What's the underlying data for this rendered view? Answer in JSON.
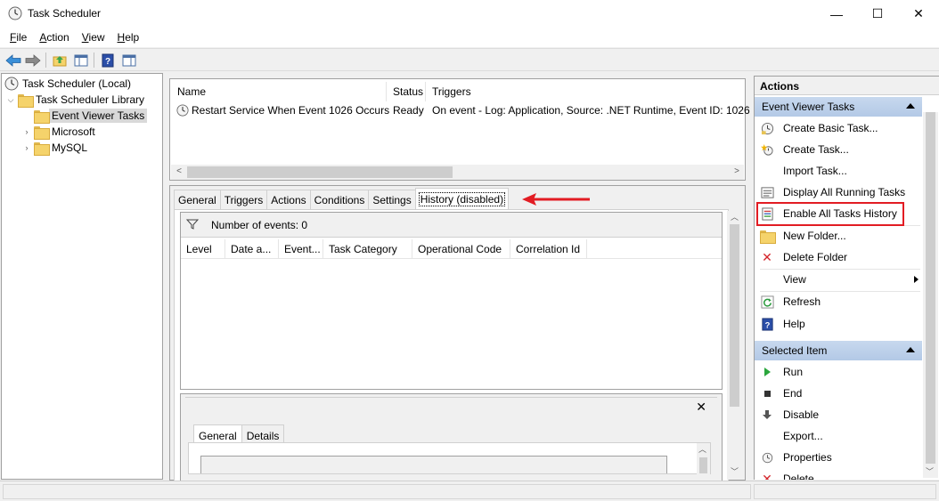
{
  "window": {
    "title": "Task Scheduler"
  },
  "window_controls": {
    "minimize": "—",
    "maximize": "☐",
    "close": "✕"
  },
  "menu": {
    "file": "File",
    "action": "Action",
    "view": "View",
    "help": "Help"
  },
  "menu_hotkeys": {
    "file": "F",
    "action": "A",
    "view": "V",
    "help": "H"
  },
  "menu_rest": {
    "file": "ile",
    "action": "ction",
    "view": "iew",
    "help": "elp"
  },
  "tree": {
    "root": "Task Scheduler (Local)",
    "library": "Task Scheduler Library",
    "items": [
      "Event Viewer Tasks",
      "Microsoft",
      "MySQL"
    ]
  },
  "task_list": {
    "columns": [
      "Name",
      "Status",
      "Triggers"
    ],
    "rows": [
      {
        "name": "Restart Service When Event 1026 Occurs",
        "status": "Ready",
        "triggers": "On event - Log: Application, Source: .NET Runtime, Event ID: 1026"
      }
    ]
  },
  "detail_tabs": [
    "General",
    "Triggers",
    "Actions",
    "Conditions",
    "Settings",
    "History (disabled)"
  ],
  "history": {
    "events_count": "Number of events: 0",
    "columns": [
      "Level",
      "Date a...",
      "Event...",
      "Task Category",
      "Operational Code",
      "Correlation Id"
    ],
    "close": "✕",
    "inner_tabs": [
      "General",
      "Details"
    ]
  },
  "actions": {
    "title": "Actions",
    "section1": "Event Viewer Tasks",
    "section1_items": [
      "Create Basic Task...",
      "Create Task...",
      "Import Task...",
      "Display All Running Tasks",
      "Enable All Tasks History",
      "New Folder...",
      "Delete Folder",
      "View",
      "Refresh",
      "Help"
    ],
    "section2": "Selected Item",
    "section2_items": [
      "Run",
      "End",
      "Disable",
      "Export...",
      "Properties",
      "Delete"
    ]
  },
  "colors": {
    "highlight_red": "#e21c23",
    "section_blue": "#bcd0ea",
    "accent": "#0a6ab8"
  }
}
